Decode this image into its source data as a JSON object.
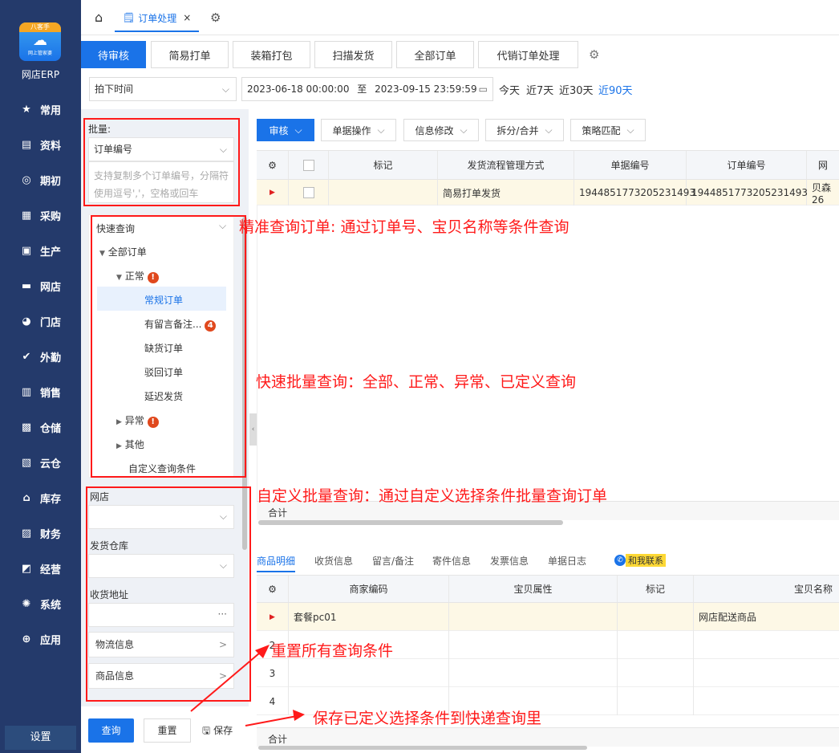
{
  "sidebar": {
    "logo_top": "八客手",
    "logo_sub": "网上管家婆",
    "brand": "网店ERP",
    "items": [
      {
        "label": "常用",
        "icon": "star-icon"
      },
      {
        "label": "资料",
        "icon": "document-icon"
      },
      {
        "label": "期初",
        "icon": "target-icon"
      },
      {
        "label": "采购",
        "icon": "cart-icon"
      },
      {
        "label": "生产",
        "icon": "factory-icon"
      },
      {
        "label": "网店",
        "icon": "shop-icon"
      },
      {
        "label": "门店",
        "icon": "pie-icon"
      },
      {
        "label": "外勤",
        "icon": "check-icon"
      },
      {
        "label": "销售",
        "icon": "bar-chart-icon"
      },
      {
        "label": "仓储",
        "icon": "warehouse-icon"
      },
      {
        "label": "云仓",
        "icon": "cloud-warehouse-icon"
      },
      {
        "label": "库存",
        "icon": "home-icon"
      },
      {
        "label": "财务",
        "icon": "money-icon"
      },
      {
        "label": "经营",
        "icon": "trend-icon"
      },
      {
        "label": "系统",
        "icon": "gear-icon"
      },
      {
        "label": "应用",
        "icon": "plus-icon"
      }
    ],
    "settings": "设置"
  },
  "topbar": {
    "tab_label": "订单处理",
    "close": "×"
  },
  "subtabs": [
    "待审核",
    "简易打单",
    "装箱打包",
    "扫描发货",
    "全部订单",
    "代销订单处理"
  ],
  "filter": {
    "time_type": "拍下时间",
    "date_from": "2023-06-18 00:00:00",
    "date_to_sep": "至",
    "date_to": "2023-09-15 23:59:59",
    "quick": [
      "今天",
      "近7天",
      "近30天",
      "近90天"
    ]
  },
  "left": {
    "batch_label": "批量:",
    "batch_field": "订单编号",
    "batch_placeholder_1": "支持复制多个订单编号，分隔符",
    "batch_placeholder_2": "使用逗号','，空格或回车",
    "quick_query": "快速查询",
    "tree": {
      "all": "全部订单",
      "normal": "正常",
      "normal_badge": "!",
      "regular": "常规订单",
      "message": "有留言备注...",
      "message_badge": "4",
      "shortage": "缺货订单",
      "rejected": "驳回订单",
      "delayed": "延迟发货",
      "abnormal": "异常",
      "abnormal_badge": "!",
      "other": "其他",
      "custom": "自定义查询条件"
    },
    "shop_label": "网店",
    "warehouse_label": "发货仓库",
    "address_label": "收货地址",
    "address_more": "···",
    "logistics": "物流信息",
    "goods": "商品信息",
    "btn_query": "查询",
    "btn_reset": "重置",
    "btn_save": "保存"
  },
  "toolbar": [
    "审核",
    "单据操作",
    "信息修改",
    "拆分/合并",
    "策略匹配"
  ],
  "order_grid": {
    "headers": [
      "标记",
      "发货流程管理方式",
      "单据编号",
      "订单编号",
      "网"
    ],
    "row": {
      "process": "简易打单发货",
      "doc_no": "1944851773205231493",
      "order_no": "1944851773205231493",
      "shop": "贝森26"
    },
    "total": "合计"
  },
  "bottom_tabs": [
    "商品明细",
    "收货信息",
    "留言/备注",
    "寄件信息",
    "发票信息",
    "单据日志"
  ],
  "contact": "和我联系",
  "detail_grid": {
    "headers": [
      "商家编码",
      "宝贝属性",
      "标记",
      "宝贝名称"
    ],
    "rows": [
      {
        "num": "",
        "code": "套餐pc01",
        "name": "网店配送商品"
      },
      {
        "num": "2",
        "code": "",
        "name": ""
      },
      {
        "num": "3",
        "code": "",
        "name": ""
      },
      {
        "num": "4",
        "code": "",
        "name": ""
      }
    ],
    "total": "合计"
  },
  "annotations": {
    "precise": "精准查询订单: 通过订单号、宝贝名称等条件查询",
    "quick_batch": "快速批量查询：全部、正常、异常、已定义查询",
    "custom_batch": "自定义批量查询：通过自定义选择条件批量查询订单",
    "reset": "重置所有查询条件",
    "save": "保存已定义选择条件到快递查询里"
  }
}
